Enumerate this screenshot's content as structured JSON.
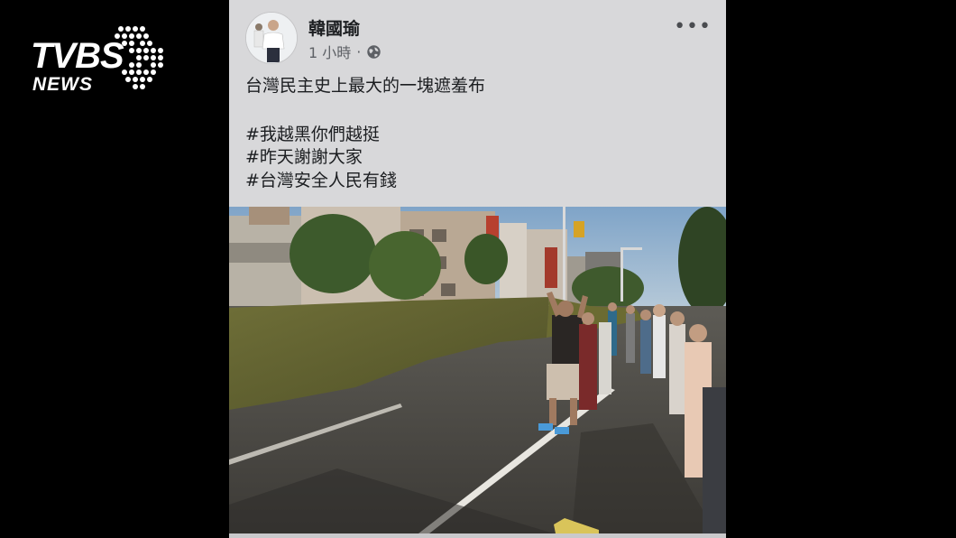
{
  "logo": {
    "main": "TVBS",
    "sub": "NEWS"
  },
  "post": {
    "author": "韓國瑜",
    "time": "1 小時",
    "separator": "·",
    "privacy_icon": "globe-icon",
    "more_icon": "more-options-icon",
    "more_label": "•••",
    "body_line": "台灣民主史上最大的一塊遮羞布",
    "hashtags": [
      "#我越黑你們越挺",
      "#昨天謝謝大家",
      "#台灣安全人民有錢"
    ]
  },
  "colors": {
    "page_bg": "#000000",
    "card_bg": "#d8d8da",
    "text": "#1c1e21",
    "meta_text": "#5e6166",
    "banner_cloth": "#6b6b32"
  }
}
